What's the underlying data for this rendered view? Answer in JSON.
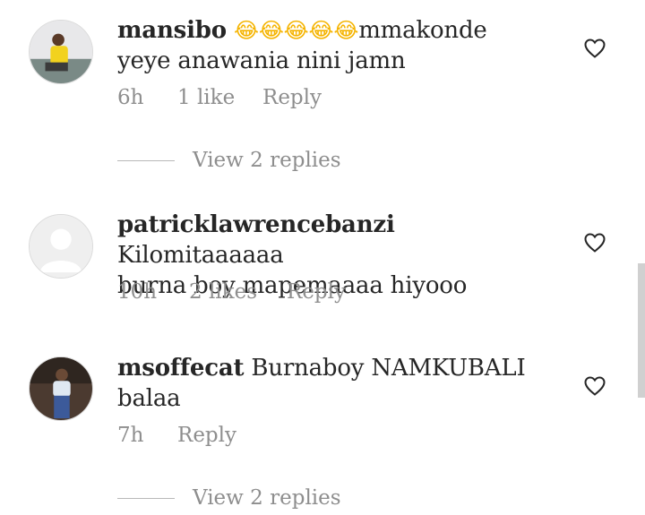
{
  "comments": [
    {
      "username": "mansibo",
      "emoji": "😂😂😂😂😂",
      "text_line1": "mmakonde",
      "text_line2": "yeye anawania nini jamn",
      "time": "6h",
      "likes": "1 like",
      "reply": "Reply",
      "view_replies": "View 2 replies"
    },
    {
      "username": "patricklawrencebanzi",
      "text_line1": " Kilomitaaaaaa",
      "text_line2": "burna boy mapemaaaa hiyooo",
      "time": "10h",
      "likes": "2 likes",
      "reply": "Reply"
    },
    {
      "username": "msoffecat",
      "text_line1": " Burnaboy NAMKUBALI",
      "text_line2": "balaa",
      "time": "7h",
      "reply": "Reply",
      "view_replies": "View 2 replies"
    }
  ]
}
